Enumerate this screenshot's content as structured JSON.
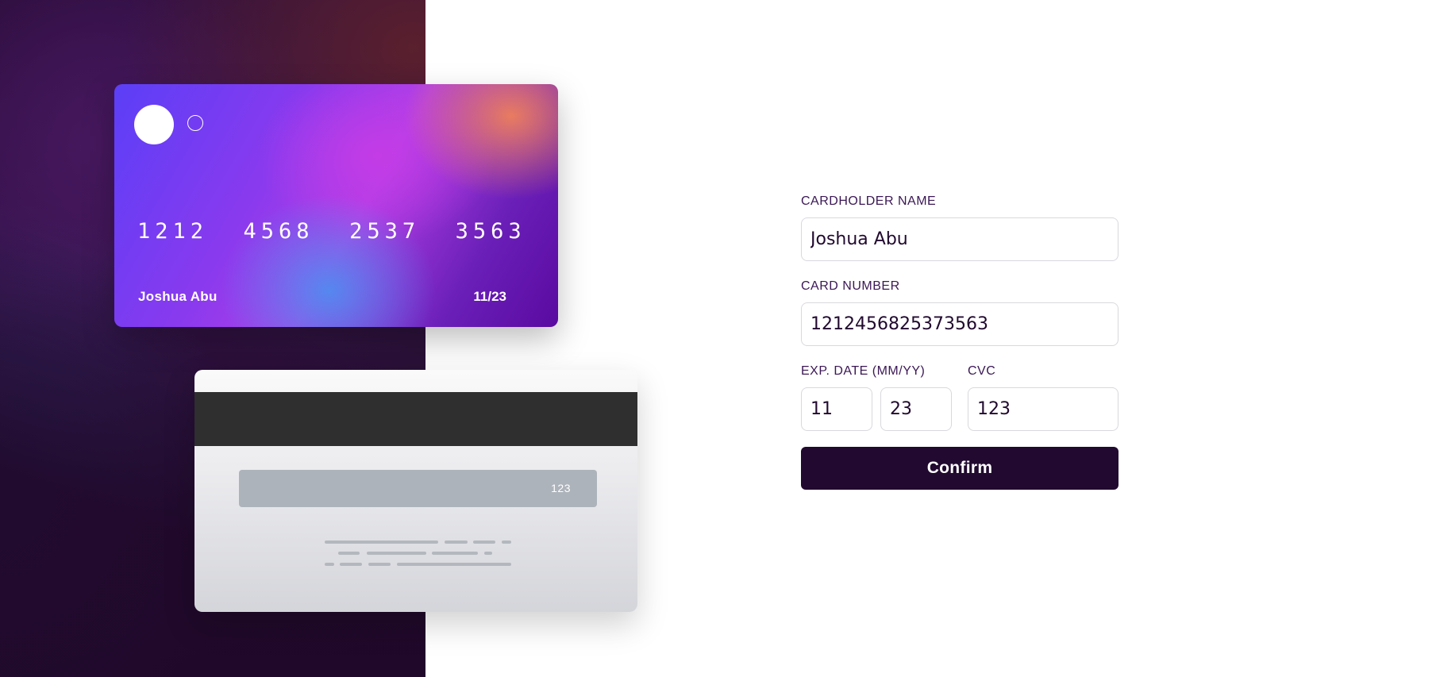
{
  "card_front": {
    "number": "1212  4568  2537  3563",
    "holder": "Joshua Abu",
    "expiry": "11/23"
  },
  "card_back": {
    "cvc": "123"
  },
  "form": {
    "cardholder_label": "CARDHOLDER NAME",
    "cardholder_value": "Joshua Abu",
    "number_label": "CARD NUMBER",
    "number_value": "1212456825373563",
    "exp_label": "EXP. DATE (MM/YY)",
    "exp_month_value": "11",
    "exp_year_value": "23",
    "cvc_label": "CVC",
    "cvc_value": "123",
    "confirm_label": "Confirm"
  },
  "colors": {
    "dark_violet": "#21092f",
    "label_purple": "#3b1755",
    "input_border": "#d9d9de"
  }
}
